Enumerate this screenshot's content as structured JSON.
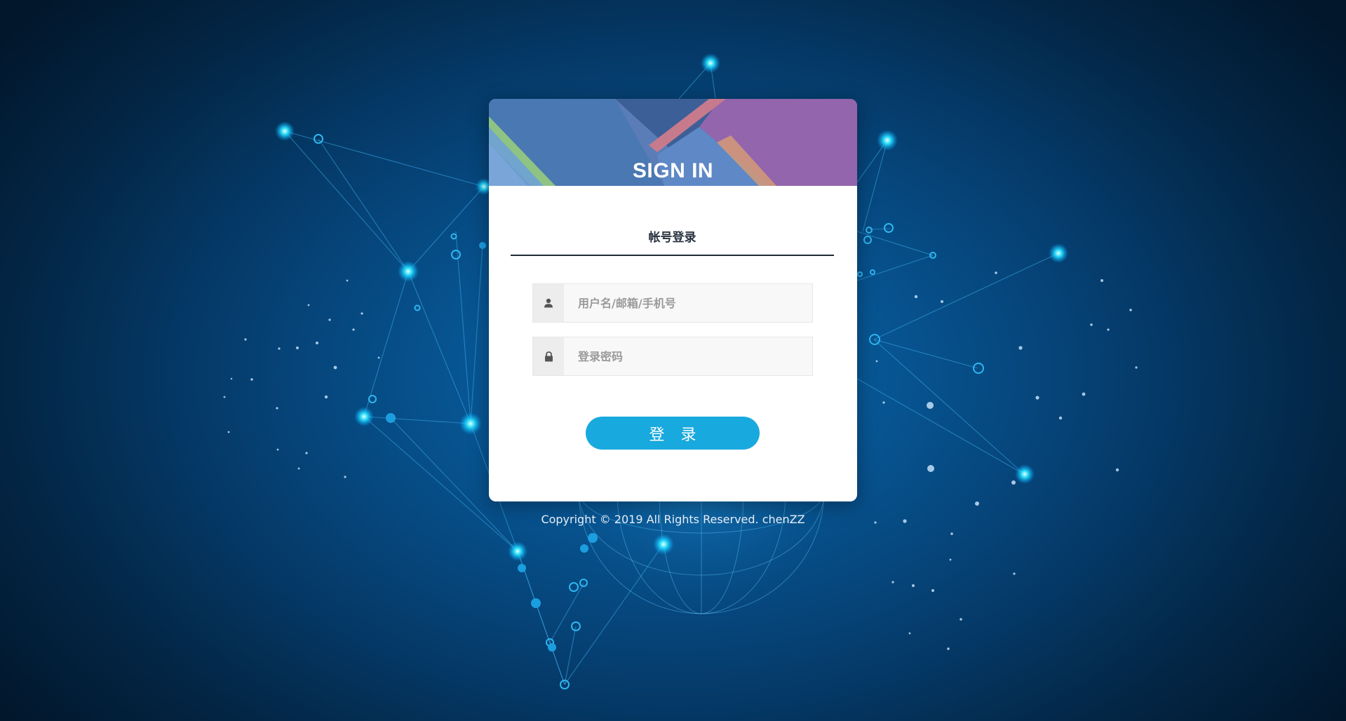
{
  "banner": {
    "title": "SIGN IN"
  },
  "login_form": {
    "tab_label": "帐号登录",
    "username": {
      "placeholder": "用户名/邮箱/手机号",
      "value": "",
      "icon": "user-icon"
    },
    "password": {
      "placeholder": "登录密码",
      "value": "",
      "icon": "lock-icon"
    },
    "submit_label": "登 录"
  },
  "footer": {
    "copyright": "Copyright © 2019 All Rights Reserved. chenZZ"
  },
  "colors": {
    "accent": "#18a9de",
    "background": "#064a83",
    "card": "#ffffff",
    "tab_underline": "#1e2a34"
  }
}
